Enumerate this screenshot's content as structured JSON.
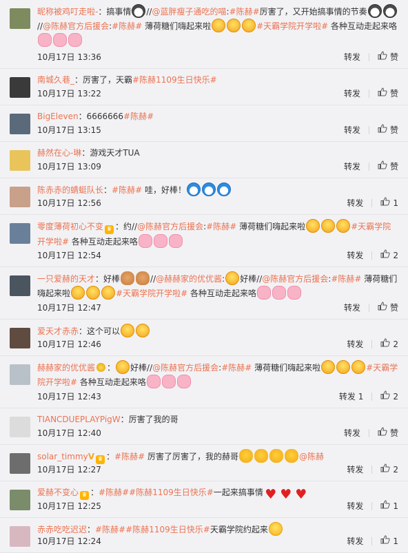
{
  "actions": {
    "forward": "转发",
    "like": "赞"
  },
  "comments": [
    {
      "user": "昵称被鸡叮走啦-",
      "parts": [
        {
          "t": "txt",
          "v": "："
        },
        {
          "t": "txt",
          "v": "搞事情"
        },
        {
          "t": "emo",
          "k": "husky"
        },
        {
          "t": "txt",
          "v": "//"
        },
        {
          "t": "at",
          "v": "@蓝胖瘦子通吃的喵"
        },
        {
          "t": "txt",
          "v": ":"
        },
        {
          "t": "tag",
          "v": "#陈赫#"
        },
        {
          "t": "txt",
          "v": "厉害了，又开始搞事情的节奏"
        },
        {
          "t": "emo",
          "k": "husky"
        },
        {
          "t": "emo",
          "k": "husky"
        },
        {
          "t": "txt",
          "v": "//"
        },
        {
          "t": "at",
          "v": "@陈赫官方后援会"
        },
        {
          "t": "txt",
          "v": ":"
        },
        {
          "t": "tag",
          "v": "#陈赫#"
        },
        {
          "t": "txt",
          "v": " 薄荷糖们嗨起来啦"
        },
        {
          "t": "emo",
          "k": "grin"
        },
        {
          "t": "emo",
          "k": "grin"
        },
        {
          "t": "emo",
          "k": "grin"
        },
        {
          "t": "tag",
          "v": "#天霸学院开学啦#"
        },
        {
          "t": "txt",
          "v": " 各种互动走起来咯"
        },
        {
          "t": "emo",
          "k": "pig"
        },
        {
          "t": "emo",
          "k": "pig"
        },
        {
          "t": "emo",
          "k": "pig"
        }
      ],
      "time": "10月17日 13:36",
      "forward": "转发",
      "like": "赞"
    },
    {
      "user": "南城久巷_",
      "parts": [
        {
          "t": "txt",
          "v": "：厉害了，天霸"
        },
        {
          "t": "tag",
          "v": "#陈赫1109生日快乐#"
        }
      ],
      "time": "10月17日 13:22",
      "forward": "转发",
      "like": "赞"
    },
    {
      "user": "BigEleven",
      "parts": [
        {
          "t": "txt",
          "v": "：6666666"
        },
        {
          "t": "tag",
          "v": "#陈赫#"
        }
      ],
      "time": "10月17日 13:15",
      "forward": "转发",
      "like": "赞"
    },
    {
      "user": "赫然在心-琳",
      "parts": [
        {
          "t": "txt",
          "v": "：游戏天才TUA"
        }
      ],
      "time": "10月17日 13:09",
      "forward": "转发",
      "like": "赞"
    },
    {
      "user": "陈赤赤的蜻蜓队长",
      "parts": [
        {
          "t": "txt",
          "v": "："
        },
        {
          "t": "tag",
          "v": "#陈赫#"
        },
        {
          "t": "txt",
          "v": " 哇，好棒！"
        },
        {
          "t": "emo",
          "k": "dora"
        },
        {
          "t": "emo",
          "k": "dora"
        },
        {
          "t": "emo",
          "k": "dora"
        }
      ],
      "time": "10月17日 12:56",
      "forward": "转发",
      "like": "1"
    },
    {
      "user": "零度薄荷初心不变",
      "badge": "vip",
      "parts": [
        {
          "t": "txt",
          "v": "：约//"
        },
        {
          "t": "at",
          "v": "@陈赫官方后援会"
        },
        {
          "t": "txt",
          "v": ":"
        },
        {
          "t": "tag",
          "v": "#陈赫#"
        },
        {
          "t": "txt",
          "v": " 薄荷糖们嗨起来啦"
        },
        {
          "t": "emo",
          "k": "grin"
        },
        {
          "t": "emo",
          "k": "grin"
        },
        {
          "t": "emo",
          "k": "grin"
        },
        {
          "t": "tag",
          "v": "#天霸学院开学啦#"
        },
        {
          "t": "txt",
          "v": " 各种互动走起来咯"
        },
        {
          "t": "emo",
          "k": "pig"
        },
        {
          "t": "emo",
          "k": "pig"
        },
        {
          "t": "emo",
          "k": "pig"
        }
      ],
      "time": "10月17日 12:54",
      "forward": "转发",
      "like": "2"
    },
    {
      "user": "一只爱赫的天才",
      "parts": [
        {
          "t": "txt",
          "v": "：好棒"
        },
        {
          "t": "emo",
          "k": "mon"
        },
        {
          "t": "emo",
          "k": "mon"
        },
        {
          "t": "txt",
          "v": "//"
        },
        {
          "t": "at",
          "v": "@赫赫家的优优酱"
        },
        {
          "t": "txt",
          "v": ":"
        },
        {
          "t": "emo",
          "k": "grin"
        },
        {
          "t": "txt",
          "v": "好棒//"
        },
        {
          "t": "at",
          "v": "@陈赫官方后援会"
        },
        {
          "t": "txt",
          "v": ":"
        },
        {
          "t": "tag",
          "v": "#陈赫#"
        },
        {
          "t": "txt",
          "v": " 薄荷糖们嗨起来啦"
        },
        {
          "t": "emo",
          "k": "grin"
        },
        {
          "t": "emo",
          "k": "grin"
        },
        {
          "t": "emo",
          "k": "grin"
        },
        {
          "t": "tag",
          "v": "#天霸学院开学啦#"
        },
        {
          "t": "txt",
          "v": " 各种互动走起来咯"
        },
        {
          "t": "emo",
          "k": "pig"
        },
        {
          "t": "emo",
          "k": "pig"
        },
        {
          "t": "emo",
          "k": "pig"
        }
      ],
      "time": "10月17日 12:47",
      "forward": "转发",
      "like": "赞"
    },
    {
      "user": "爱天才赤赤",
      "parts": [
        {
          "t": "txt",
          "v": "：这个可以"
        },
        {
          "t": "emo",
          "k": "grin"
        },
        {
          "t": "emo",
          "k": "grin"
        }
      ],
      "time": "10月17日 12:46",
      "forward": "转发",
      "like": "2"
    },
    {
      "user": "赫赫家的优优酱",
      "badge": "medal",
      "parts": [
        {
          "t": "txt",
          "v": "："
        },
        {
          "t": "emo",
          "k": "grin"
        },
        {
          "t": "txt",
          "v": "好棒//"
        },
        {
          "t": "at",
          "v": "@陈赫官方后援会"
        },
        {
          "t": "txt",
          "v": ":"
        },
        {
          "t": "tag",
          "v": "#陈赫#"
        },
        {
          "t": "txt",
          "v": " 薄荷糖们嗨起来啦"
        },
        {
          "t": "emo",
          "k": "grin"
        },
        {
          "t": "emo",
          "k": "grin"
        },
        {
          "t": "emo",
          "k": "grin"
        },
        {
          "t": "tag",
          "v": "#天霸学院开学啦#"
        },
        {
          "t": "txt",
          "v": " 各种互动走起来咯"
        },
        {
          "t": "emo",
          "k": "pig"
        },
        {
          "t": "emo",
          "k": "pig"
        },
        {
          "t": "emo",
          "k": "pig"
        }
      ],
      "time": "10月17日 12:43",
      "forward": "转发 1",
      "like": "2"
    },
    {
      "user": "TIANCDUEPLAYPigW",
      "parts": [
        {
          "t": "txt",
          "v": "：厉害了我的哥"
        }
      ],
      "time": "10月17日 12:40",
      "forward": "转发",
      "like": "赞"
    },
    {
      "user": "solar_timmy",
      "badge": "v-vip",
      "parts": [
        {
          "t": "txt",
          "v": "："
        },
        {
          "t": "tag",
          "v": "#陈赫#"
        },
        {
          "t": "txt",
          "v": " 厉害了厉害了，我的赫哥"
        },
        {
          "t": "emo",
          "k": "head"
        },
        {
          "t": "emo",
          "k": "head"
        },
        {
          "t": "emo",
          "k": "head"
        },
        {
          "t": "emo",
          "k": "head"
        },
        {
          "t": "at",
          "v": "@陈赫"
        }
      ],
      "time": "10月17日 12:27",
      "forward": "转发",
      "like": "2"
    },
    {
      "user": "爱赫不变心",
      "badge": "vip",
      "parts": [
        {
          "t": "txt",
          "v": "："
        },
        {
          "t": "tag",
          "v": "#陈赫#"
        },
        {
          "t": "tag",
          "v": "#陈赫1109生日快乐#"
        },
        {
          "t": "txt",
          "v": "一起来搞事情"
        },
        {
          "t": "emo",
          "k": "heart"
        },
        {
          "t": "emo",
          "k": "heart"
        },
        {
          "t": "emo",
          "k": "heart"
        }
      ],
      "time": "10月17日 12:25",
      "forward": "转发",
      "like": "1"
    },
    {
      "user": "赤赤吃吃迟迟",
      "parts": [
        {
          "t": "txt",
          "v": "："
        },
        {
          "t": "tag",
          "v": "#陈赫#"
        },
        {
          "t": "tag",
          "v": "#陈赫1109生日快乐#"
        },
        {
          "t": "txt",
          "v": "天霸学院约起来"
        },
        {
          "t": "emo",
          "k": "face"
        }
      ],
      "time": "10月17日 12:24",
      "forward": "转发",
      "like": "1"
    }
  ]
}
